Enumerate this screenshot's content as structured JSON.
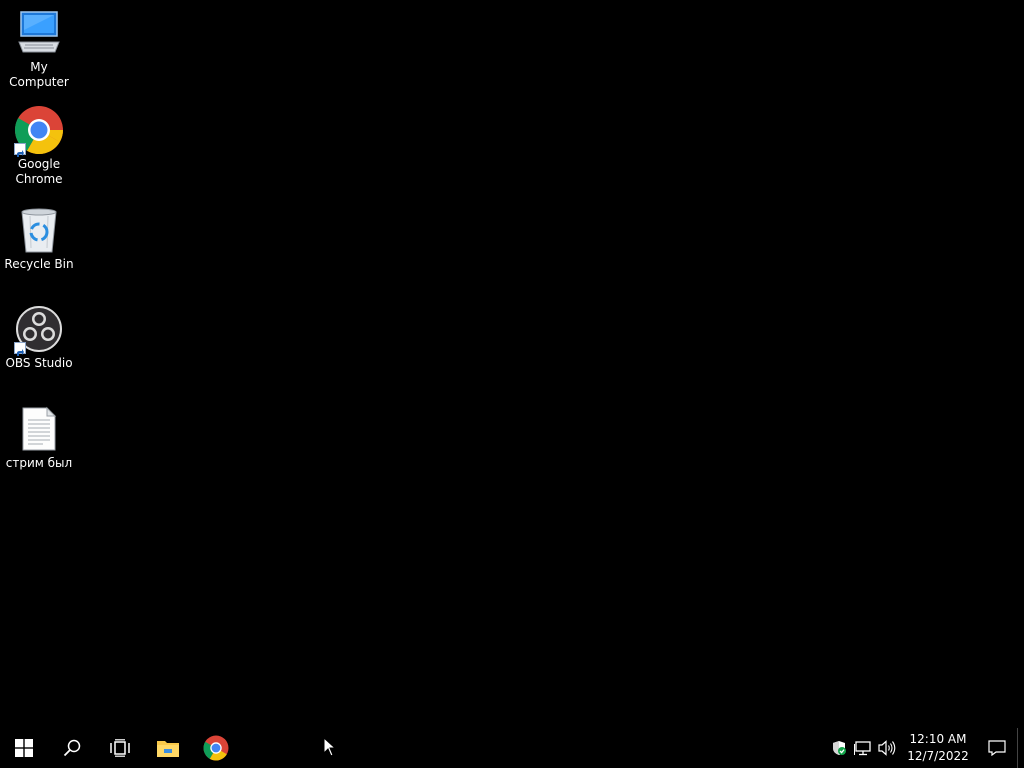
{
  "desktop": {
    "icons": [
      {
        "label": "My Computer",
        "icon": "computer-icon",
        "shortcut": false
      },
      {
        "label": "Google Chrome",
        "icon": "chrome-icon",
        "shortcut": true
      },
      {
        "label": "Recycle Bin",
        "icon": "recycle-bin-icon",
        "shortcut": false
      },
      {
        "label": "OBS Studio",
        "icon": "obs-icon",
        "shortcut": true
      },
      {
        "label": "стрим был",
        "icon": "text-file-icon",
        "shortcut": false
      }
    ]
  },
  "taskbar": {
    "items": [
      {
        "name": "start-button",
        "icon": "windows-logo-icon"
      },
      {
        "name": "search-button",
        "icon": "search-icon"
      },
      {
        "name": "task-view-button",
        "icon": "task-view-icon"
      },
      {
        "name": "file-explorer-button",
        "icon": "folder-icon"
      },
      {
        "name": "chrome-taskbar-button",
        "icon": "chrome-icon"
      }
    ],
    "tray": {
      "icons": [
        "security-shield-icon",
        "network-icon",
        "volume-icon"
      ],
      "time": "12:10 AM",
      "date": "12/7/2022"
    }
  },
  "colors": {
    "background": "#000000",
    "text": "#ffffff",
    "chrome_red": "#db4437",
    "chrome_yellow": "#f4c20d",
    "chrome_green": "#0f9d58",
    "chrome_blue": "#4285f4",
    "folder_yellow": "#f8c84a"
  }
}
